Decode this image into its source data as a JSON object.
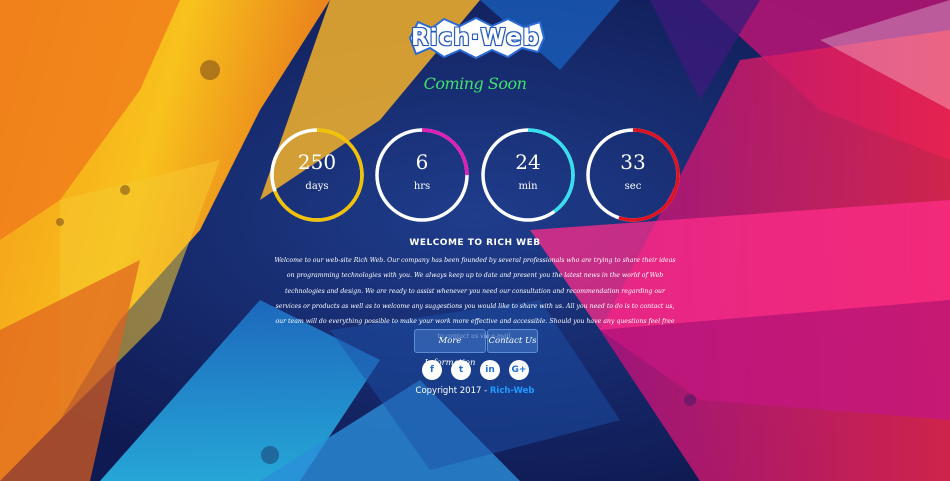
{
  "logo": {
    "text": "Rich·Web"
  },
  "tagline": "Coming Soon",
  "countdown": [
    {
      "value": "250",
      "unit": "days",
      "color": "#f2c200",
      "progress": 0.69
    },
    {
      "value": "6",
      "unit": "hrs",
      "color": "#e01fb8",
      "progress": 0.25
    },
    {
      "value": "24",
      "unit": "min",
      "color": "#34e0f0",
      "progress": 0.4
    },
    {
      "value": "33",
      "unit": "sec",
      "color": "#e0101f",
      "progress": 0.55
    }
  ],
  "welcome": {
    "title": "WELCOME TO RICH WEB",
    "text": "Welcome to our web-site Rich Web. Our company has been founded by several professionals who are trying to share their ideas on programming technologies with you. We always keep up to date and present you the latest news in the world of Web technologies and design. We are ready to assist whenever you need our consultation and recommendation regarding our services or products as well as to welcome any suggestions you would like to share with us. All you need to do is to contact us, our team will do everything possible to make your work more effective and accessible. Should you have any questions feel free to contact us via e-mail."
  },
  "buttons": {
    "more_info": "More Information",
    "contact": "Contact Us"
  },
  "social": [
    {
      "name": "facebook-icon",
      "glyph": "f"
    },
    {
      "name": "twitter-icon",
      "glyph": "t"
    },
    {
      "name": "linkedin-icon",
      "glyph": "in"
    },
    {
      "name": "google-plus-icon",
      "glyph": "G+"
    }
  ],
  "footer": {
    "copyright": "Copyright 2017 - ",
    "brand": "Rich-Web"
  },
  "colors": {
    "accent": "#3ee26a",
    "brand_blue": "#1e9bff"
  }
}
